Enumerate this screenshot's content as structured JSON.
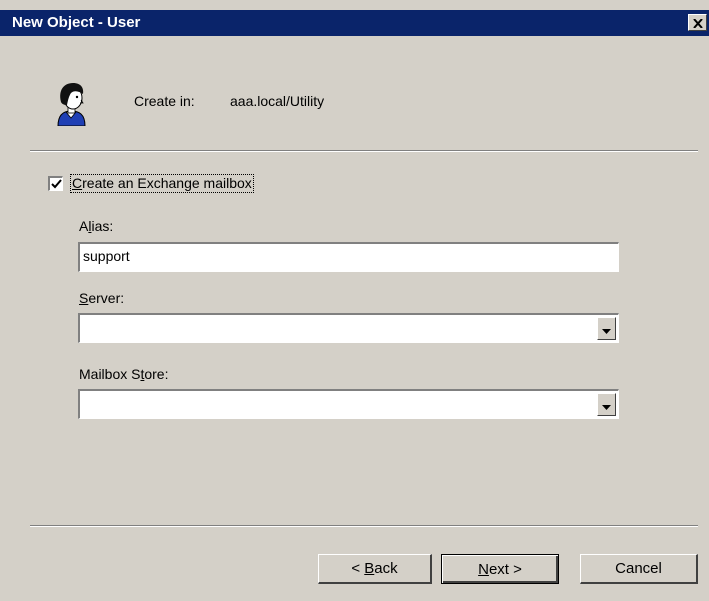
{
  "window": {
    "title": "New Object - User",
    "close_glyph": "✕"
  },
  "header": {
    "icon": "user-icon",
    "create_in_label": "Create in:",
    "create_in_value": "aaa.local/Utility"
  },
  "mailbox": {
    "checkbox_checked": true,
    "checkbox_label_prefix": "",
    "checkbox_label_accel": "C",
    "checkbox_label_rest": "reate an Exchange mailbox"
  },
  "alias": {
    "label_prefix": "A",
    "label_accel": "l",
    "label_rest": "ias:",
    "value": "support"
  },
  "server": {
    "label_prefix": "",
    "label_accel": "S",
    "label_rest": "erver:",
    "selected": ""
  },
  "store": {
    "label_prefix": "Mailbox S",
    "label_accel": "t",
    "label_rest": "ore:",
    "selected": ""
  },
  "buttons": {
    "back_prefix": "< ",
    "back_accel": "B",
    "back_rest": "ack",
    "next_prefix": "",
    "next_accel": "N",
    "next_rest": "ext >",
    "cancel": "Cancel"
  },
  "colors": {
    "titlebar": "#0a246a",
    "dialog_bg": "#d4d0c8"
  }
}
